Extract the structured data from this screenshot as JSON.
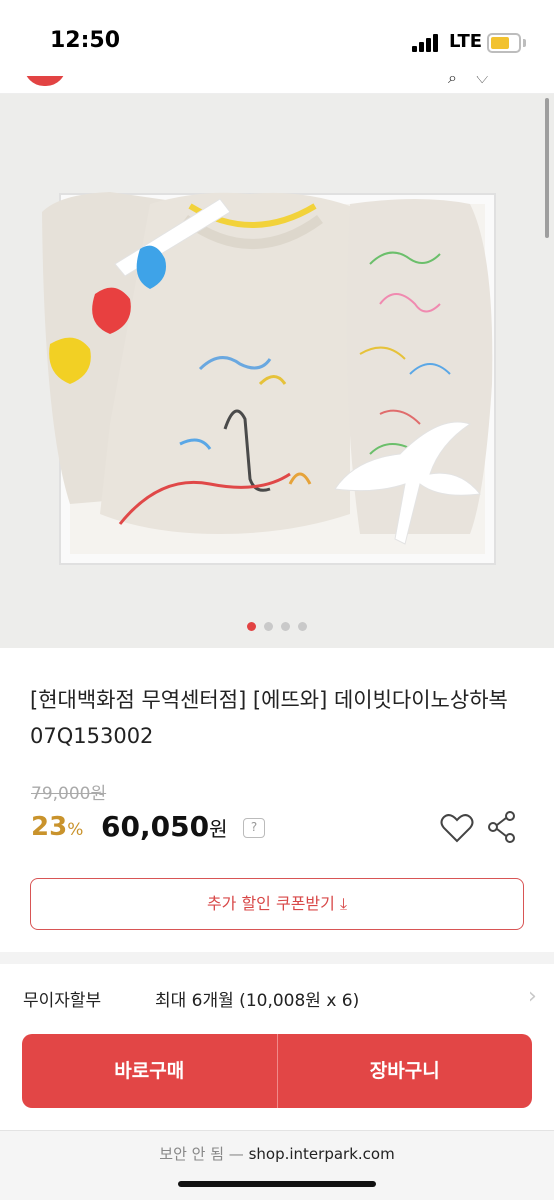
{
  "status_bar": {
    "time": "12:50",
    "network": "LTE",
    "battery_color": "#f2c230"
  },
  "gallery": {
    "image_alt": "",
    "dot_count": 4,
    "active_index": 0
  },
  "product": {
    "title": "[현대백화점 무역센터점] [에뜨와] 데이빗다이노상하복 07Q153002",
    "original_price": "79,000원",
    "discount_value": "23",
    "discount_unit": "%",
    "price_value": "60,050",
    "price_unit": "원",
    "help_symbol": "?"
  },
  "coupon": {
    "label": "추가 할인 쿠폰받기"
  },
  "installment": {
    "label": "무이자할부",
    "value": "최대 6개월 (10,008원 x 6)"
  },
  "actions": {
    "buy_now": "바로구매",
    "cart": "장바구니",
    "color": "#e24646"
  },
  "browser": {
    "insecure_label": "보안 안 됨 —",
    "url": "shop.interpark.com"
  },
  "colors": {
    "accent": "#e24343",
    "discount": "#c9932c"
  }
}
